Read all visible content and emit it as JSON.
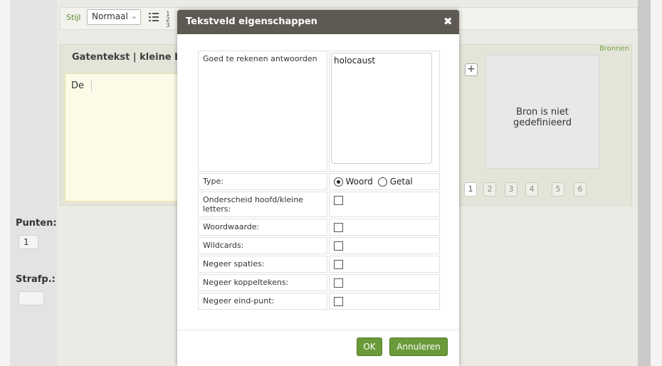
{
  "toolbar": {
    "style_label": "Stijl",
    "style_value": "Normaal",
    "numlist_glyph": "1\n2\n3"
  },
  "question": {
    "title": "Gatentekst | kleine bro",
    "sources_label": "Bronnen",
    "editor_text": "De",
    "add_glyph": "+",
    "source_placeholder": "Bron is niet gedefinieerd",
    "pages": [
      "1",
      "2",
      "3",
      "4",
      "5",
      "6"
    ],
    "active_page": "1"
  },
  "scoring": {
    "points_label": "Punten:",
    "points_value": "1",
    "penalty_label": "Strafp.:",
    "penalty_value": ""
  },
  "dialog": {
    "title": "Tekstveld eigenschappen",
    "close_glyph": "✖",
    "answers_label": "Goed te rekenen antwoorden",
    "answers_value": "holocaust",
    "type_label": "Type:",
    "type_options": [
      "Woord",
      "Getal"
    ],
    "type_selected": "Woord",
    "options": [
      {
        "label": "Onderscheid hoofd/kleine letters:",
        "checked": false
      },
      {
        "label": "Woordwaarde:",
        "checked": false
      },
      {
        "label": "Wildcards:",
        "checked": false
      },
      {
        "label": "Negeer spaties:",
        "checked": false
      },
      {
        "label": "Negeer koppeltekens:",
        "checked": false
      },
      {
        "label": "Negeer eind-punt:",
        "checked": false
      }
    ],
    "ok_label": "OK",
    "cancel_label": "Annuleren"
  },
  "colors": {
    "accent": "#6b9a3a",
    "header": "#5f5953",
    "sources": "#7aa04a"
  }
}
